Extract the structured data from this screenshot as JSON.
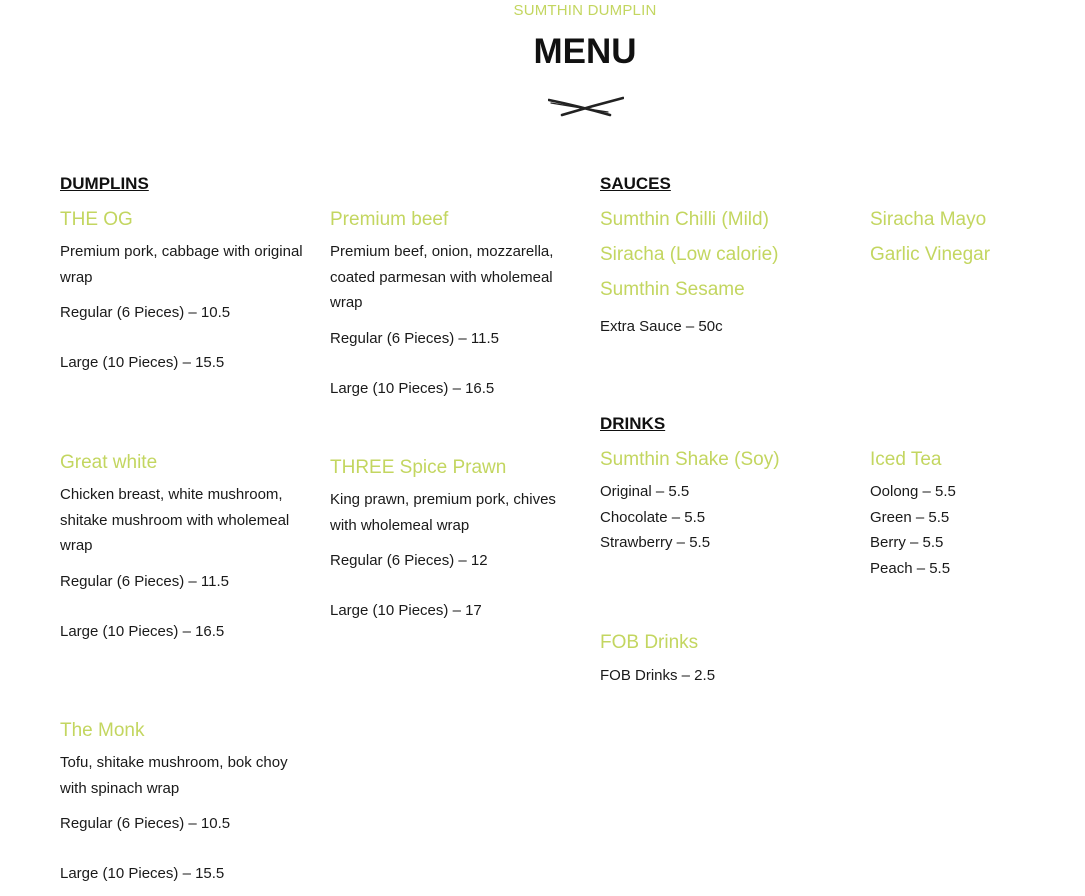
{
  "brand": "SUMTHIN DUMPLIN",
  "title": "MENU",
  "colors": {
    "accent": "#c3d660",
    "text": "#1a1a1a"
  },
  "icons": {
    "divider": "chopsticks-icon"
  },
  "dumplings": {
    "heading": "DUMPLINS",
    "items": [
      {
        "name": "THE OG",
        "desc": "Premium pork, cabbage with original wrap",
        "regular": "Regular (6 Pieces) – 10.5",
        "large": "Large (10 Pieces) – 15.5"
      },
      {
        "name": "Premium beef",
        "desc": "Premium beef, onion, mozzarella, coated parmesan with wholemeal wrap",
        "regular": "Regular (6 Pieces) – 11.5",
        "large": "Large (10 Pieces) – 16.5"
      },
      {
        "name": "Great white",
        "desc": "Chicken breast, white mushroom, shitake mushroom with wholemeal wrap",
        "regular": "Regular (6 Pieces) – 11.5",
        "large": "Large (10 Pieces) – 16.5"
      },
      {
        "name": "THREE Spice Prawn",
        "desc": "King prawn, premium pork, chives with wholemeal wrap",
        "regular": "Regular (6 Pieces) – 12",
        "large": "Large (10 Pieces) – 17"
      },
      {
        "name": "The Monk",
        "desc": "Tofu, shitake mushroom, bok choy with spinach wrap",
        "regular": "Regular (6 Pieces) – 10.5",
        "large": "Large (10 Pieces) – 15.5"
      }
    ]
  },
  "sauces": {
    "heading": "SAUCES",
    "items": [
      "Sumthin Chilli (Mild)",
      "Siracha Mayo",
      "Siracha (Low calorie)",
      "Garlic Vinegar",
      "Sumthin Sesame"
    ],
    "extra": "Extra Sauce – 50c"
  },
  "drinks": {
    "heading": "DRINKS",
    "shake": {
      "name": "Sumthin Shake (Soy)",
      "options": [
        "Original – 5.5",
        "Chocolate – 5.5",
        "Strawberry – 5.5"
      ]
    },
    "tea": {
      "name": "Iced Tea",
      "options": [
        "Oolong – 5.5",
        "Green – 5.5",
        "Berry – 5.5",
        "Peach – 5.5"
      ]
    },
    "fob": {
      "name": "FOB Drinks",
      "price": "FOB Drinks – 2.5"
    }
  }
}
